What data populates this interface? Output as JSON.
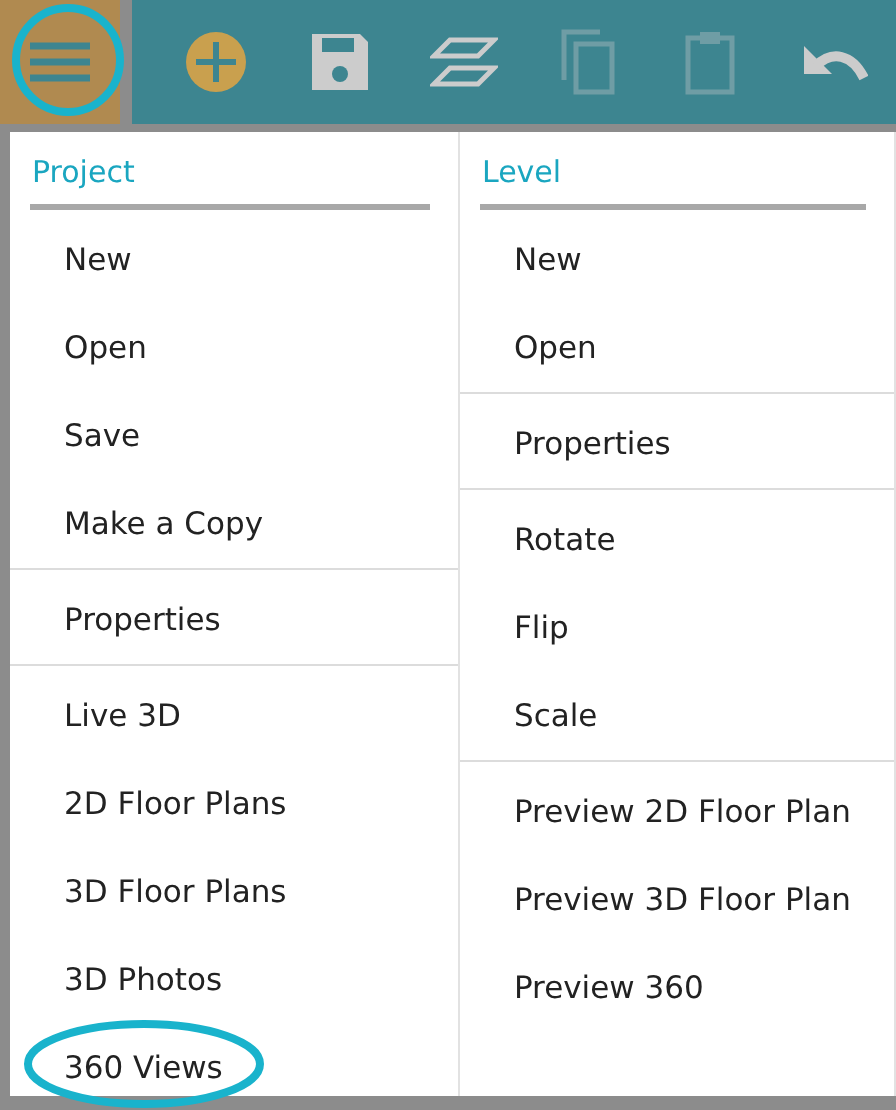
{
  "toolbar": {
    "menu_button": {
      "highlighted": true
    },
    "buttons": [
      {
        "kind": "add",
        "disabled": false
      },
      {
        "kind": "save",
        "disabled": false
      },
      {
        "kind": "levels",
        "disabled": false
      },
      {
        "kind": "copy",
        "disabled": true
      },
      {
        "kind": "paste",
        "disabled": true
      },
      {
        "kind": "undo",
        "disabled": false
      }
    ]
  },
  "menu": {
    "columns": [
      {
        "heading": "Project",
        "groups": [
          [
            {
              "label": "New",
              "highlighted": false
            },
            {
              "label": "Open",
              "highlighted": false
            },
            {
              "label": "Save",
              "highlighted": false
            },
            {
              "label": "Make a Copy",
              "highlighted": false
            }
          ],
          [
            {
              "label": "Properties",
              "highlighted": false
            }
          ],
          [
            {
              "label": "Live 3D",
              "highlighted": false
            },
            {
              "label": "2D Floor Plans",
              "highlighted": false
            },
            {
              "label": "3D Floor Plans",
              "highlighted": false
            },
            {
              "label": "3D Photos",
              "highlighted": false
            },
            {
              "label": "360 Views",
              "highlighted": true
            }
          ]
        ]
      },
      {
        "heading": "Level",
        "groups": [
          [
            {
              "label": "New",
              "highlighted": false
            },
            {
              "label": "Open",
              "highlighted": false
            }
          ],
          [
            {
              "label": "Properties",
              "highlighted": false
            }
          ],
          [
            {
              "label": "Rotate",
              "highlighted": false
            },
            {
              "label": "Flip",
              "highlighted": false
            },
            {
              "label": "Scale",
              "highlighted": false
            }
          ],
          [
            {
              "label": "Preview 2D Floor Plan",
              "highlighted": false
            },
            {
              "label": "Preview 3D Floor Plan",
              "highlighted": false
            },
            {
              "label": "Preview 360",
              "highlighted": false
            }
          ]
        ]
      }
    ]
  }
}
